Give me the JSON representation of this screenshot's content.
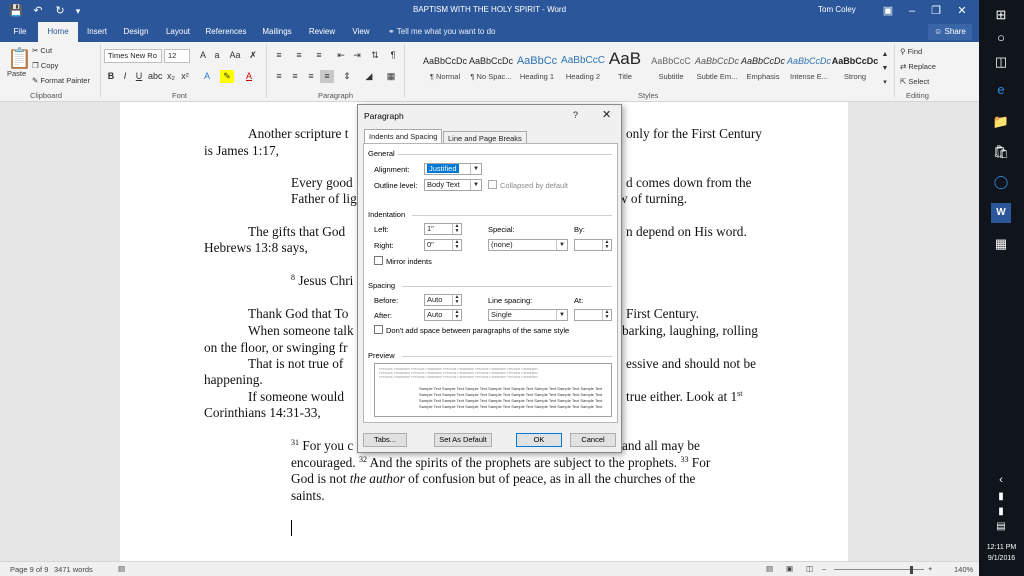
{
  "titlebar": {
    "doc_title": "BAPTISM  WITH THE HOLY SPIRIT - Word",
    "user": "Tom Coley"
  },
  "tabs": [
    "File",
    "Home",
    "Insert",
    "Design",
    "Layout",
    "References",
    "Mailings",
    "Review",
    "View"
  ],
  "tell_me": "Tell me what you want to do",
  "share": "Share",
  "ribbon": {
    "clipboard": {
      "paste": "Paste",
      "cut": "Cut",
      "copy": "Copy",
      "format_painter": "Format Painter",
      "label": "Clipboard"
    },
    "font": {
      "name": "Times New Ro",
      "size": "12",
      "label": "Font"
    },
    "paragraph": {
      "label": "Paragraph"
    },
    "styles": {
      "label": "Styles",
      "items": [
        {
          "preview": "AaBbCcDc",
          "name": "¶ Normal"
        },
        {
          "preview": "AaBbCcDc",
          "name": "¶ No Spac..."
        },
        {
          "preview": "AaBbCc",
          "name": "Heading 1"
        },
        {
          "preview": "AaBbCcC",
          "name": "Heading 2"
        },
        {
          "preview": "AaB",
          "name": "Title"
        },
        {
          "preview": "AaBbCcC",
          "name": "Subtitle"
        },
        {
          "preview": "AaBbCcDc",
          "name": "Subtle Em..."
        },
        {
          "preview": "AaBbCcDc",
          "name": "Emphasis"
        },
        {
          "preview": "AaBbCcDc",
          "name": "Intense E..."
        },
        {
          "preview": "AaBbCcDc",
          "name": "Strong"
        }
      ]
    },
    "editing": {
      "find": "Find",
      "replace": "Replace",
      "select": "Select",
      "label": "Editing"
    }
  },
  "document": {
    "lines": [
      "Another scripture t",
      "only for the First Century",
      "is James 1:17,",
      "Every good",
      "d comes down from the",
      "Father of lig",
      "w of turning.",
      "The gifts that God",
      "n depend on His word.",
      "Hebrews 13:8 says,",
      "8",
      " Jesus Chri",
      "Thank God that To",
      "First Century.",
      "When someone talk",
      "barking, laughing, rolling",
      "on the floor, or swinging fr",
      "That is not true of",
      "essive and should not be",
      "happening.",
      "If someone would",
      "true either. Look at 1",
      "st",
      "Corinthians 14:31-33,",
      "31",
      " For you c",
      "and all may be",
      "encouraged. ",
      "32",
      " And the spirits of the prophets are subject to the prophets. ",
      "33",
      " For",
      "God is not ",
      "the author",
      " of confusion but of peace, as in all the churches of the",
      "saints."
    ]
  },
  "statusbar": {
    "page": "Page 9 of 9",
    "words": "3471 words",
    "zoom": "140%"
  },
  "taskbar": {
    "time": "12:11 PM",
    "date": "9/1/2016"
  },
  "dialog": {
    "title": "Paragraph",
    "help": "?",
    "tabs": [
      "Indents and Spacing",
      "Line and Page Breaks"
    ],
    "general": {
      "heading": "General",
      "alignment_label": "Alignment:",
      "alignment": "Justified",
      "outline_label": "Outline level:",
      "outline": "Body Text",
      "collapsed": "Collapsed by default"
    },
    "indentation": {
      "heading": "Indentation",
      "left_label": "Left:",
      "left": "1\"",
      "right_label": "Right:",
      "right": "0\"",
      "special_label": "Special:",
      "special": "(none)",
      "by_label": "By:",
      "by": "",
      "mirror": "Mirror indents"
    },
    "spacing": {
      "heading": "Spacing",
      "before_label": "Before:",
      "before": "Auto",
      "after_label": "After:",
      "after": "Auto",
      "line_label": "Line spacing:",
      "line": "Single",
      "at_label": "At:",
      "at": "",
      "dont_add": "Don't add space between paragraphs of the same style"
    },
    "preview": {
      "heading": "Preview",
      "prev_text": "Previous Paragraph Previous Paragraph Previous Paragraph Previous Paragraph Previous Paragraph",
      "sample_text": "Sample Text Sample Text Sample Text Sample Text Sample Text Sample Text Sample Text Sample Text"
    },
    "buttons": {
      "tabs": "Tabs...",
      "default": "Set As Default",
      "ok": "OK",
      "cancel": "Cancel"
    }
  }
}
